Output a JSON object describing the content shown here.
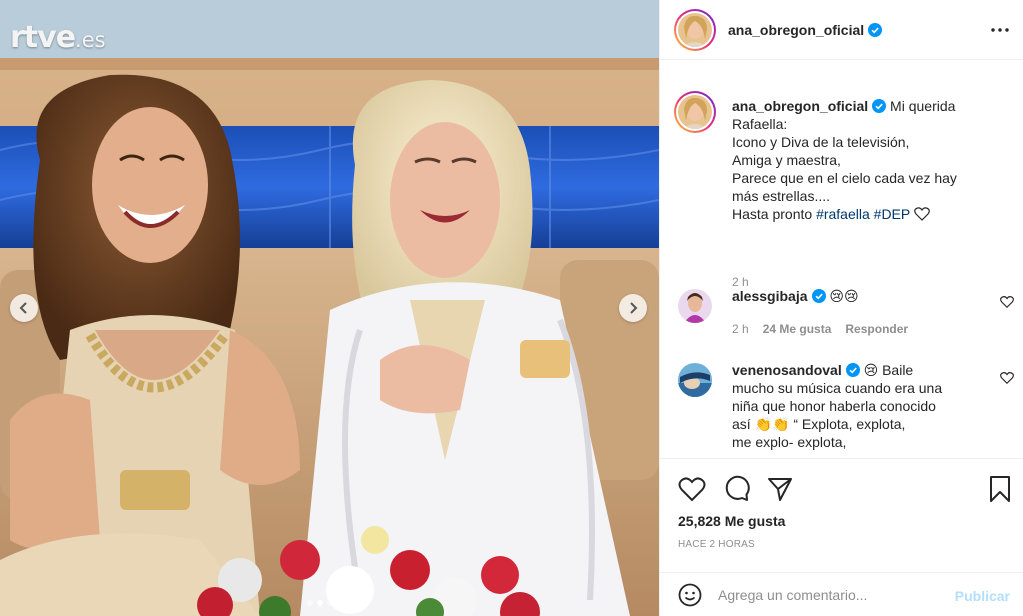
{
  "media": {
    "watermark": "rtve",
    "watermark_suffix": ".es",
    "carousel_dots": 5,
    "active_dot": 1
  },
  "post": {
    "author": "ana_obregon_oficial",
    "verified": true,
    "caption": {
      "user": "ana_obregon_oficial",
      "lines": [
        "Mi querida",
        "Rafaella:",
        "Icono y Diva de la televisión,",
        "Amiga y maestra,",
        "Parece que en el cielo cada vez hay",
        "más estrellas....",
        "Hasta pronto"
      ],
      "hashtag1": "#rafaella",
      "hashtag2": "#DEP",
      "time": "2 h"
    },
    "comments": [
      {
        "user": "alessgibaja",
        "verified": true,
        "text": "😢😢",
        "time": "2 h",
        "likes": "24 Me gusta",
        "reply": "Responder"
      },
      {
        "user": "venenosandoval",
        "verified": true,
        "lines": [
          "😢 Baile",
          "mucho su música cuando era una",
          "niña que honor haberla conocido",
          "así 👏👏 “ Explota, explota,",
          "me explo- explota,"
        ]
      }
    ],
    "likes_count": "25,828 Me gusta",
    "time_ago": "HACE 2 HORAS",
    "comment_placeholder": "Agrega un comentario...",
    "publish_label": "Publicar"
  },
  "colors": {
    "verified_blue": "#0095f6",
    "link_blue": "#00376b",
    "publish_disabled": "#b2dffc",
    "muted_text": "#8e8e8e"
  },
  "icons": {
    "more": "more-horizontal-icon",
    "like": "heart-outline-icon",
    "comment": "comment-bubble-icon",
    "share": "paper-plane-icon",
    "save": "bookmark-icon",
    "emoji": "smiley-icon",
    "prev": "chevron-left-icon",
    "next": "chevron-right-icon"
  }
}
